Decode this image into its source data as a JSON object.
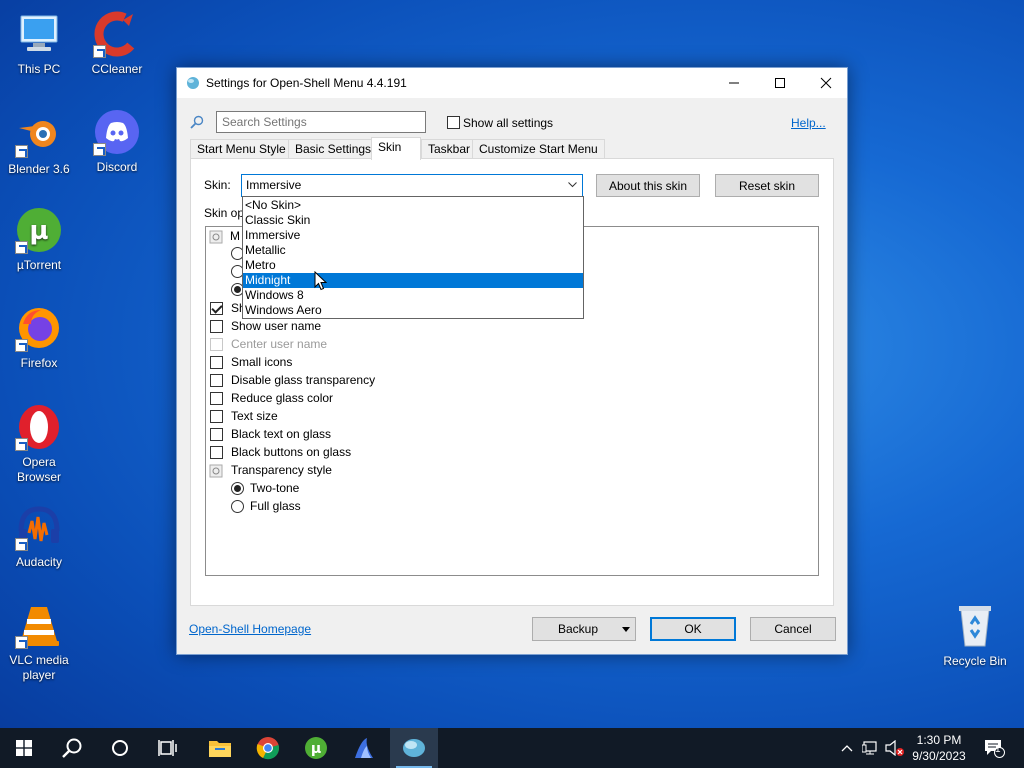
{
  "desktop": {
    "icons": [
      {
        "label": "This PC"
      },
      {
        "label": "CCleaner"
      },
      {
        "label": "Blender 3.6"
      },
      {
        "label": "Discord"
      },
      {
        "label": "µTorrent"
      },
      {
        "label": "Firefox"
      },
      {
        "label": "Opera Browser"
      },
      {
        "label": "Audacity"
      },
      {
        "label": "VLC media player"
      },
      {
        "label": "Recycle Bin"
      }
    ]
  },
  "window": {
    "title": "Settings for Open-Shell Menu 4.4.191",
    "search_placeholder": "Search Settings",
    "show_all_label": "Show all settings",
    "help_link": "Help...",
    "tabs": [
      {
        "label": "Start Menu Style"
      },
      {
        "label": "Basic Settings"
      },
      {
        "label": "Skin"
      },
      {
        "label": "Taskbar"
      },
      {
        "label": "Customize Start Menu"
      }
    ],
    "active_tab": "Skin",
    "skin_label": "Skin:",
    "skin_value": "Immersive",
    "about_skin_button": "About this skin",
    "reset_skin_button": "Reset skin",
    "skin_options_label": "Skin op",
    "dropdown_options": [
      "<No Skin>",
      "Classic Skin",
      "Immersive",
      "Metallic",
      "Metro",
      "Midnight",
      "Windows 8",
      "Windows Aero"
    ],
    "dropdown_highlighted": "Midnight",
    "options_partial": {
      "group_first_letter": "M",
      "checked_item_prefix": "Sh"
    },
    "options": [
      {
        "label": "Show user name",
        "checked": false,
        "disabled": false
      },
      {
        "label": "Center user name",
        "checked": false,
        "disabled": true
      },
      {
        "label": "Small icons",
        "checked": false,
        "disabled": false
      },
      {
        "label": "Disable glass transparency",
        "checked": false,
        "disabled": false
      },
      {
        "label": "Reduce glass color",
        "checked": false,
        "disabled": false
      },
      {
        "label": "Text size",
        "checked": false,
        "disabled": false
      },
      {
        "label": "Black text on glass",
        "checked": false,
        "disabled": false
      },
      {
        "label": "Black buttons on glass",
        "checked": false,
        "disabled": false
      }
    ],
    "transparency_group": "Transparency style",
    "transparency_options": [
      {
        "label": "Two-tone",
        "checked": true
      },
      {
        "label": "Full glass",
        "checked": false
      }
    ],
    "homepage_link": "Open-Shell Homepage",
    "backup_button": "Backup",
    "ok_button": "OK",
    "cancel_button": "Cancel"
  },
  "taskbar": {
    "time": "1:30 PM",
    "date": "9/30/2023",
    "notification_count": "1"
  },
  "colors": {
    "accent": "#0078d7",
    "taskbar": "#111a26",
    "link": "#0066cc"
  }
}
